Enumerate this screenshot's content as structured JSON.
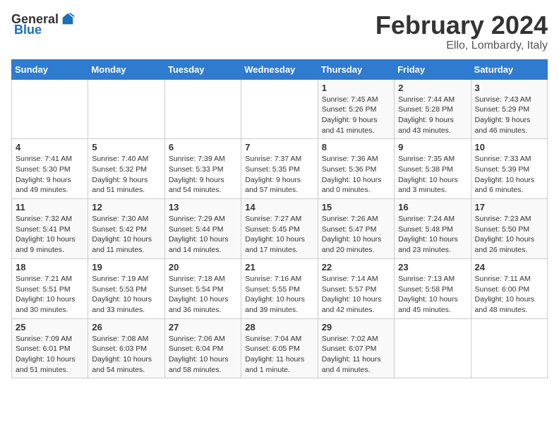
{
  "header": {
    "logo_general": "General",
    "logo_blue": "Blue",
    "month_title": "February 2024",
    "location": "Ello, Lombardy, Italy"
  },
  "calendar": {
    "days_of_week": [
      "Sunday",
      "Monday",
      "Tuesday",
      "Wednesday",
      "Thursday",
      "Friday",
      "Saturday"
    ],
    "weeks": [
      [
        {
          "day": "",
          "info": ""
        },
        {
          "day": "",
          "info": ""
        },
        {
          "day": "",
          "info": ""
        },
        {
          "day": "",
          "info": ""
        },
        {
          "day": "1",
          "info": "Sunrise: 7:45 AM\nSunset: 5:26 PM\nDaylight: 9 hours\nand 41 minutes."
        },
        {
          "day": "2",
          "info": "Sunrise: 7:44 AM\nSunset: 5:28 PM\nDaylight: 9 hours\nand 43 minutes."
        },
        {
          "day": "3",
          "info": "Sunrise: 7:43 AM\nSunset: 5:29 PM\nDaylight: 9 hours\nand 46 minutes."
        }
      ],
      [
        {
          "day": "4",
          "info": "Sunrise: 7:41 AM\nSunset: 5:30 PM\nDaylight: 9 hours\nand 49 minutes."
        },
        {
          "day": "5",
          "info": "Sunrise: 7:40 AM\nSunset: 5:32 PM\nDaylight: 9 hours\nand 51 minutes."
        },
        {
          "day": "6",
          "info": "Sunrise: 7:39 AM\nSunset: 5:33 PM\nDaylight: 9 hours\nand 54 minutes."
        },
        {
          "day": "7",
          "info": "Sunrise: 7:37 AM\nSunset: 5:35 PM\nDaylight: 9 hours\nand 57 minutes."
        },
        {
          "day": "8",
          "info": "Sunrise: 7:36 AM\nSunset: 5:36 PM\nDaylight: 10 hours\nand 0 minutes."
        },
        {
          "day": "9",
          "info": "Sunrise: 7:35 AM\nSunset: 5:38 PM\nDaylight: 10 hours\nand 3 minutes."
        },
        {
          "day": "10",
          "info": "Sunrise: 7:33 AM\nSunset: 5:39 PM\nDaylight: 10 hours\nand 6 minutes."
        }
      ],
      [
        {
          "day": "11",
          "info": "Sunrise: 7:32 AM\nSunset: 5:41 PM\nDaylight: 10 hours\nand 9 minutes."
        },
        {
          "day": "12",
          "info": "Sunrise: 7:30 AM\nSunset: 5:42 PM\nDaylight: 10 hours\nand 11 minutes."
        },
        {
          "day": "13",
          "info": "Sunrise: 7:29 AM\nSunset: 5:44 PM\nDaylight: 10 hours\nand 14 minutes."
        },
        {
          "day": "14",
          "info": "Sunrise: 7:27 AM\nSunset: 5:45 PM\nDaylight: 10 hours\nand 17 minutes."
        },
        {
          "day": "15",
          "info": "Sunrise: 7:26 AM\nSunset: 5:47 PM\nDaylight: 10 hours\nand 20 minutes."
        },
        {
          "day": "16",
          "info": "Sunrise: 7:24 AM\nSunset: 5:48 PM\nDaylight: 10 hours\nand 23 minutes."
        },
        {
          "day": "17",
          "info": "Sunrise: 7:23 AM\nSunset: 5:50 PM\nDaylight: 10 hours\nand 26 minutes."
        }
      ],
      [
        {
          "day": "18",
          "info": "Sunrise: 7:21 AM\nSunset: 5:51 PM\nDaylight: 10 hours\nand 30 minutes."
        },
        {
          "day": "19",
          "info": "Sunrise: 7:19 AM\nSunset: 5:53 PM\nDaylight: 10 hours\nand 33 minutes."
        },
        {
          "day": "20",
          "info": "Sunrise: 7:18 AM\nSunset: 5:54 PM\nDaylight: 10 hours\nand 36 minutes."
        },
        {
          "day": "21",
          "info": "Sunrise: 7:16 AM\nSunset: 5:55 PM\nDaylight: 10 hours\nand 39 minutes."
        },
        {
          "day": "22",
          "info": "Sunrise: 7:14 AM\nSunset: 5:57 PM\nDaylight: 10 hours\nand 42 minutes."
        },
        {
          "day": "23",
          "info": "Sunrise: 7:13 AM\nSunset: 5:58 PM\nDaylight: 10 hours\nand 45 minutes."
        },
        {
          "day": "24",
          "info": "Sunrise: 7:11 AM\nSunset: 6:00 PM\nDaylight: 10 hours\nand 48 minutes."
        }
      ],
      [
        {
          "day": "25",
          "info": "Sunrise: 7:09 AM\nSunset: 6:01 PM\nDaylight: 10 hours\nand 51 minutes."
        },
        {
          "day": "26",
          "info": "Sunrise: 7:08 AM\nSunset: 6:03 PM\nDaylight: 10 hours\nand 54 minutes."
        },
        {
          "day": "27",
          "info": "Sunrise: 7:06 AM\nSunset: 6:04 PM\nDaylight: 10 hours\nand 58 minutes."
        },
        {
          "day": "28",
          "info": "Sunrise: 7:04 AM\nSunset: 6:05 PM\nDaylight: 11 hours\nand 1 minute."
        },
        {
          "day": "29",
          "info": "Sunrise: 7:02 AM\nSunset: 6:07 PM\nDaylight: 11 hours\nand 4 minutes."
        },
        {
          "day": "",
          "info": ""
        },
        {
          "day": "",
          "info": ""
        }
      ]
    ]
  }
}
